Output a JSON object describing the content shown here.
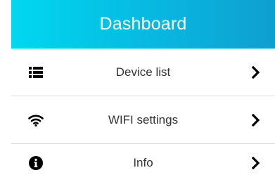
{
  "header": {
    "title": "Dashboard"
  },
  "menu": {
    "items": [
      {
        "label": "Device list",
        "icon": "list-icon"
      },
      {
        "label": "WIFI settings",
        "icon": "wifi-icon"
      },
      {
        "label": "Info",
        "icon": "info-icon"
      }
    ],
    "chevron_icon": "chevron-right-icon"
  },
  "colors": {
    "header_gradient_start": "#00d8f0",
    "header_gradient_end": "#0e9fd0",
    "header_text": "#ffffff",
    "item_text": "#333333",
    "divider": "#dcdcdc",
    "icon": "#000000"
  }
}
